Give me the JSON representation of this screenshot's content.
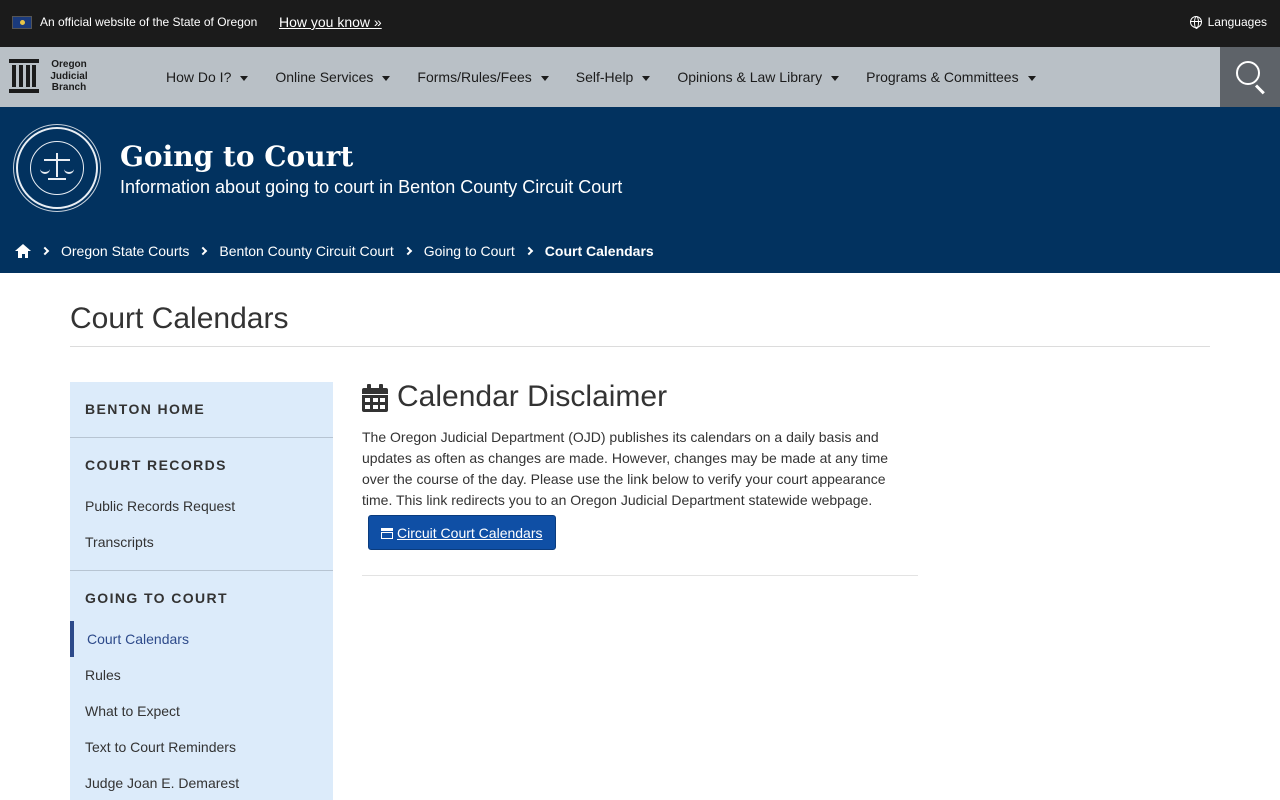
{
  "official_bar": {
    "official_text": "An official website of the State of Oregon",
    "how_you_know": "How you know »",
    "languages": "Languages"
  },
  "logo": {
    "line1": "Oregon",
    "line2": "Judicial",
    "line3": "Branch"
  },
  "nav": {
    "items": [
      {
        "label": "How Do I?"
      },
      {
        "label": "Online Services"
      },
      {
        "label": "Forms/Rules/Fees"
      },
      {
        "label": "Self-Help"
      },
      {
        "label": "Opinions & Law Library"
      },
      {
        "label": "Programs & Committees"
      }
    ]
  },
  "hero": {
    "title": "Going to Court",
    "subtitle": "Information about going to court in Benton County Circuit Court"
  },
  "breadcrumb": {
    "items": [
      {
        "label": "Oregon State Courts"
      },
      {
        "label": "Benton County Circuit Court"
      },
      {
        "label": "Going to Court"
      },
      {
        "label": "Court Calendars"
      }
    ]
  },
  "page": {
    "title": "Court Calendars"
  },
  "sidebar": {
    "sections": [
      {
        "heading": "BENTON HOME",
        "links": []
      },
      {
        "heading": "COURT RECORDS",
        "links": [
          {
            "label": "Public Records Request"
          },
          {
            "label": "Transcripts"
          }
        ]
      },
      {
        "heading": "GOING TO COURT",
        "links": [
          {
            "label": "Court Calendars"
          },
          {
            "label": "Rules"
          },
          {
            "label": "What to Expect"
          },
          {
            "label": "Text to Court Reminders"
          },
          {
            "label": "Judge Joan E. Demarest"
          }
        ]
      }
    ],
    "active": "Court Calendars"
  },
  "content": {
    "heading": "Calendar Disclaimer",
    "body": "The Oregon Judicial Department (OJD) publishes its calendars on a daily basis and updates as often as changes are made. However, changes may be made at any time over the course of the day. Please use the link below to verify your court appearance time. This link redirects you to an Oregon Judicial Department statewide webpage.",
    "button_label": "Circuit Court Calendars"
  },
  "colors": {
    "hero_bg": "#02325f",
    "nav_bg": "#b9c0c6",
    "top_bar_bg": "#1b1b1b",
    "sidebar_bg": "#dcebfa",
    "button_bg": "#0f4fa5",
    "active_accent": "#2d4a8a"
  }
}
